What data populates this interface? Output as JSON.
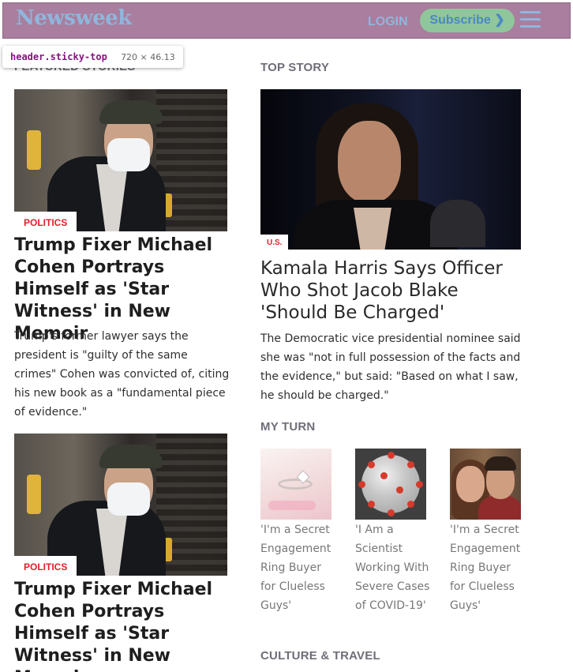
{
  "header": {
    "logo": "Newsweek",
    "login_label": "LOGIN",
    "subscribe_label": "Subscribe ❯",
    "menu_icon": "hamburger-menu-icon",
    "background": "#a97e9e",
    "accent": "#8fb6dd"
  },
  "devtools_tooltip": {
    "selector": "header.sticky-top",
    "dimensions": "720 × 46.13"
  },
  "sections": {
    "featured": "FEATURED STORIES",
    "top_story": "TOP STORY",
    "my_turn": "MY TURN",
    "culture_travel": "CULTURE & TRAVEL"
  },
  "featured_stories": [
    {
      "category": "POLITICS",
      "headline": "Trump Fixer Michael Cohen Portrays Himself as 'Star Witness' in New Memoir",
      "dek": "Trump's former lawyer says the president is \"guilty of the same crimes\" Cohen was convicted of, citing his new book as a \"fundamental piece of evidence.\"",
      "image": "michael-cohen-photo"
    },
    {
      "category": "POLITICS",
      "headline": "Trump Fixer Michael Cohen Portrays Himself as 'Star Witness' in New Memoir",
      "image": "michael-cohen-photo"
    }
  ],
  "top_story": {
    "category": "U.S.",
    "headline": "Kamala Harris Says Officer Who Shot Jacob Blake 'Should Be Charged'",
    "dek": "The Democratic vice presidential nominee said she was \"not in full possession of the facts and the evidence,\" but said: \"Based on what I saw, he should be charged.\"",
    "image": "kamala-harris-photo"
  },
  "my_turn": [
    {
      "title": "'I'm a Secret Engagement Ring Buyer for Clueless Guys'",
      "image": "engagement-ring-photo"
    },
    {
      "title": "'I Am a Scientist Working With Severe Cases of COVID-19'",
      "image": "coronavirus-photo"
    },
    {
      "title": "'I'm a Secret Engagement Ring Buyer for Clueless Guys'",
      "image": "couple-photo"
    }
  ],
  "colors": {
    "category_red": "#e0202a",
    "section_gray": "#6e6e78",
    "subscribe_green": "#8fc69b"
  }
}
